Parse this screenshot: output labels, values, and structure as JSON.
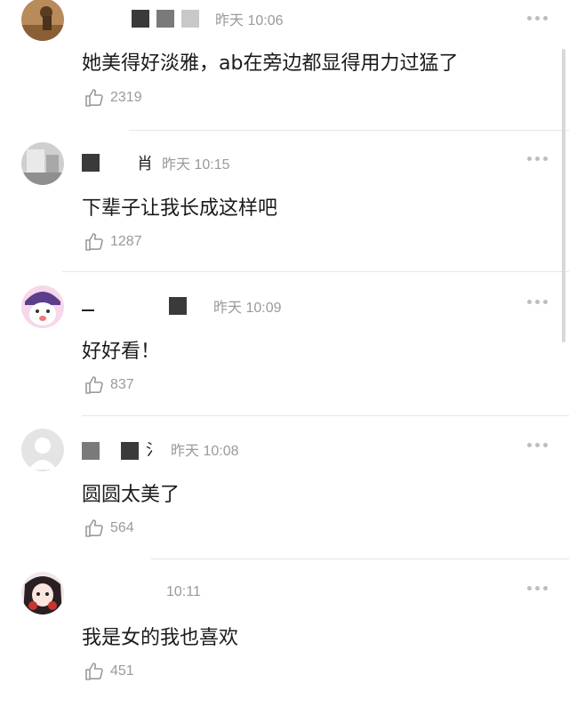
{
  "comments": [
    {
      "time": "昨天 10:06",
      "text": "她美得好淡雅，ab在旁边都显得用力过猛了",
      "likes": "2319",
      "avatar_icon": "avatar-desert-icon"
    },
    {
      "name_glyph": "肖",
      "time": "昨天 10:15",
      "text": "下辈子让我长成这样吧",
      "likes": "1287",
      "avatar_icon": "avatar-room-icon"
    },
    {
      "time": "昨天 10:09",
      "text": "好好看！",
      "likes": "837",
      "avatar_icon": "avatar-cartoon-icon"
    },
    {
      "name_glyph": "氵",
      "time": "昨天 10:08",
      "text": "圆圆太美了",
      "likes": "564",
      "avatar_icon": "avatar-default-icon"
    },
    {
      "time": "10:11",
      "text": "我是女的我也喜欢",
      "likes": "451",
      "avatar_icon": "avatar-anime-girl-icon"
    }
  ],
  "colors": {
    "meta": "#9a9a9a",
    "text": "#1a1a1a",
    "divider": "#e6e6e6"
  }
}
